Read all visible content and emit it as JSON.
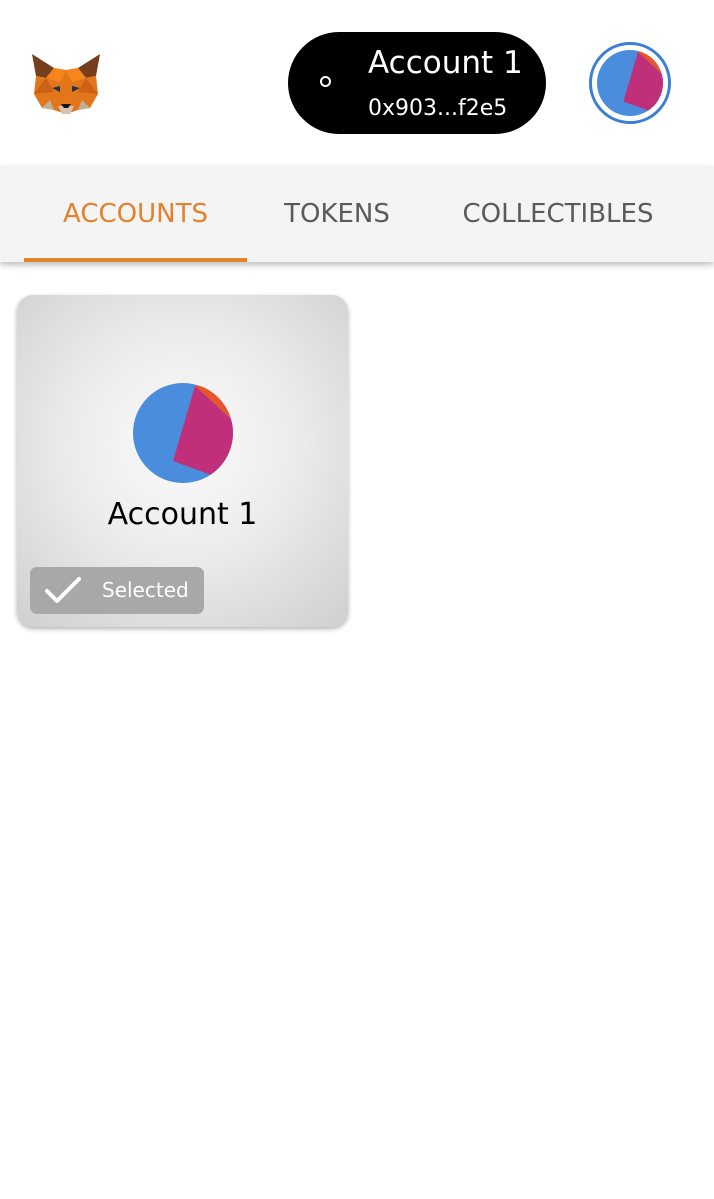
{
  "header": {
    "logo_icon": "metamask-fox-icon",
    "account_name": "Account 1",
    "account_address": "0x903...f2e5",
    "status_icon": "status-circle-icon",
    "avatar_icon": "jazzicon-avatar-icon"
  },
  "tabs": [
    {
      "label": "ACCOUNTS",
      "active": true
    },
    {
      "label": "TOKENS",
      "active": false
    },
    {
      "label": "COLLECTIBLES",
      "active": false
    }
  ],
  "accounts": [
    {
      "name": "Account 1",
      "selected_label": "Selected",
      "check_icon": "checkmark-icon"
    }
  ],
  "colors": {
    "accent": "#e2822b",
    "pill_background": "#000000",
    "tab_bar_background": "#f4f4f4",
    "tab_text": "#5a5a5a",
    "avatar_ring": "#3b7fd8",
    "selected_badge": "#a8a8a8",
    "jazzicon_blue": "#4a8ddc",
    "jazzicon_magenta": "#c0307a",
    "jazzicon_orange": "#e8552a"
  }
}
